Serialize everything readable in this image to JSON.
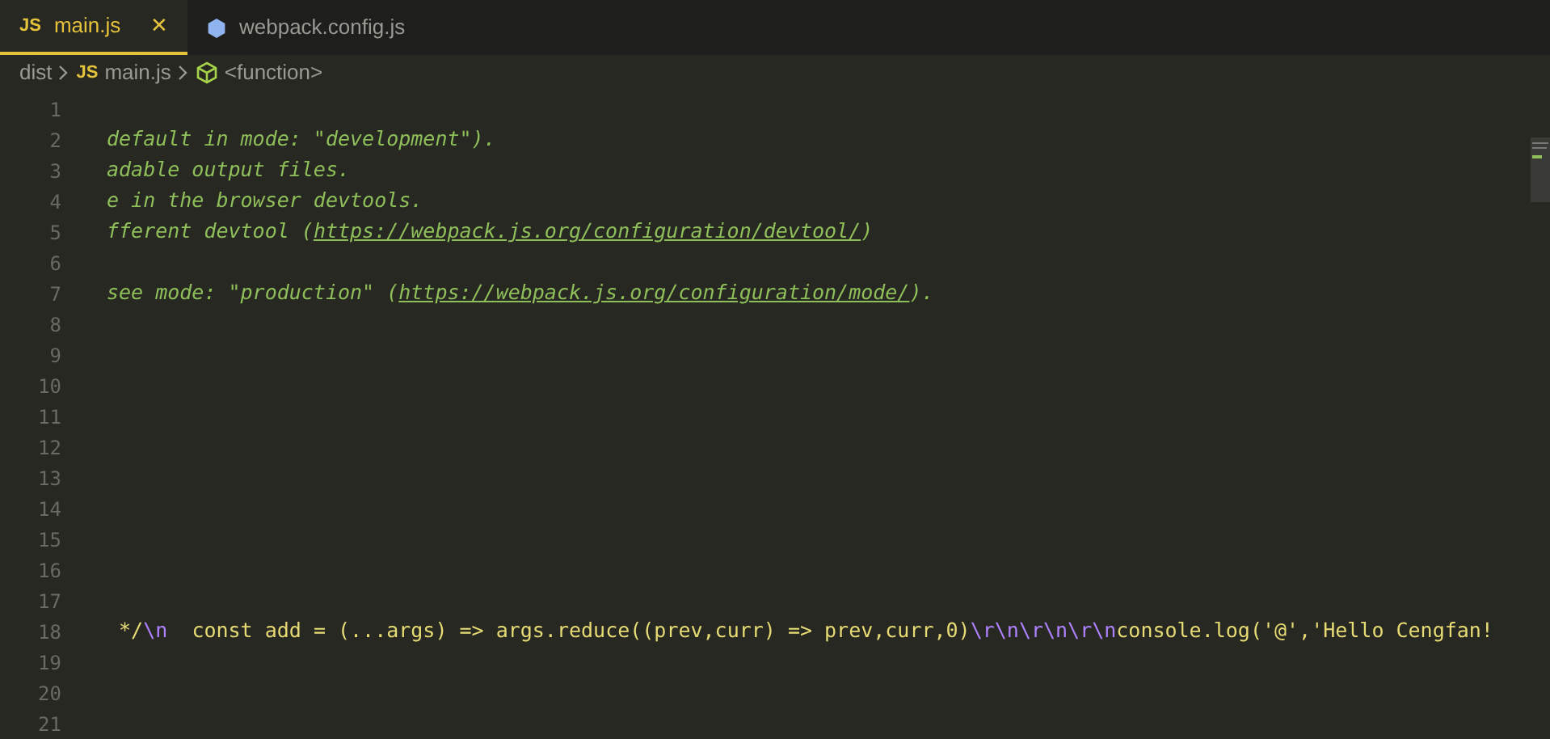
{
  "tabs": [
    {
      "label": "main.js",
      "icon": "JS",
      "kind": "js",
      "selected": true,
      "close": "✕"
    },
    {
      "label": "webpack.config.js",
      "kind": "config",
      "selected": false
    }
  ],
  "breadcrumb": [
    {
      "label": "dist",
      "kind": "folder"
    },
    {
      "label": "main.js",
      "icon": "JS",
      "kind": "js"
    },
    {
      "label": "<function>",
      "kind": "function"
    }
  ],
  "lines": [
    {
      "number": "1"
    },
    {
      "number": "2",
      "segments": [
        {
          "text": "default in mode: \"development\").",
          "kind": "comment"
        }
      ]
    },
    {
      "number": "3",
      "segments": [
        {
          "text": "adable output files.",
          "kind": "comment"
        }
      ]
    },
    {
      "number": "4",
      "segments": [
        {
          "text": "e in the browser devtools.",
          "kind": "comment"
        }
      ]
    },
    {
      "number": "5",
      "segments": [
        {
          "text": "fferent devtool (",
          "kind": "comment"
        },
        {
          "text": "https://webpack.js.org/configuration/devtool/",
          "kind": "link"
        },
        {
          "text": ")",
          "kind": "comment"
        }
      ]
    },
    {
      "number": "6"
    },
    {
      "number": "7",
      "segments": [
        {
          "text": "see mode: \"production\" (",
          "kind": "comment"
        },
        {
          "text": "https://webpack.js.org/configuration/mode/",
          "kind": "link"
        },
        {
          "text": ").",
          "kind": "comment"
        }
      ]
    },
    {
      "number": "8"
    },
    {
      "number": "9"
    },
    {
      "number": "10"
    },
    {
      "number": "11"
    },
    {
      "number": "12"
    },
    {
      "number": "13"
    },
    {
      "number": "14"
    },
    {
      "number": "15"
    },
    {
      "number": "16"
    },
    {
      "number": "17"
    },
    {
      "number": "18",
      "segments": [
        {
          "text": " */",
          "kind": "string"
        },
        {
          "text": "\\n",
          "kind": "escape"
        },
        {
          "text": "  const add = (...args) => args.reduce((prev,curr) => prev,curr,0)",
          "kind": "string"
        },
        {
          "text": "\\r\\n\\r\\n\\r\\n",
          "kind": "escape"
        },
        {
          "text": "console.log('@','Hello Cengfan!",
          "kind": "string"
        }
      ]
    },
    {
      "number": "19"
    },
    {
      "number": "20"
    },
    {
      "number": "21"
    }
  ]
}
